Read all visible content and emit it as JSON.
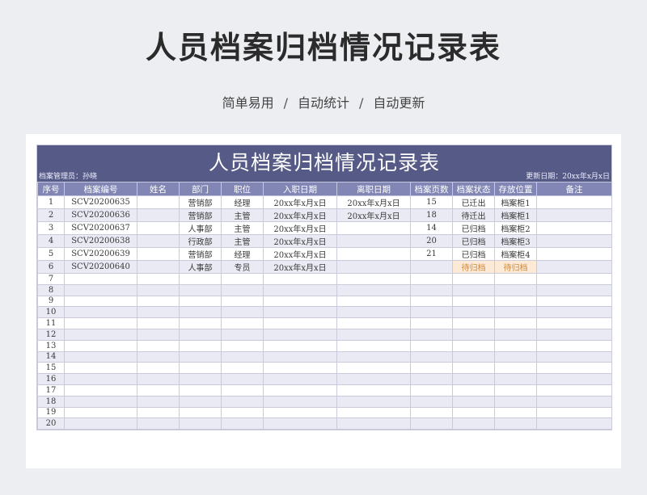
{
  "page": {
    "title": "人员档案归档情况记录表",
    "subtitle": [
      "简单易用",
      "自动统计",
      "自动更新"
    ],
    "subtitle_sep": "/"
  },
  "sheet": {
    "title": "人员档案归档情况记录表",
    "manager_label": "档案管理员：孙晓",
    "update_label": "更新日期：20xx年x月x日",
    "columns": [
      "序号",
      "档案编号",
      "姓名",
      "部门",
      "职位",
      "入职日期",
      "离职日期",
      "档案页数",
      "档案状态",
      "存放位置",
      "备注"
    ],
    "rows": [
      [
        "1",
        "SCV20200635",
        "",
        "营销部",
        "经理",
        "20xx年x月x日",
        "20xx年x月x日",
        "15",
        "已迁出",
        "档案柜1",
        ""
      ],
      [
        "2",
        "SCV20200636",
        "",
        "营销部",
        "主管",
        "20xx年x月x日",
        "20xx年x月x日",
        "18",
        "待迁出",
        "档案柜1",
        ""
      ],
      [
        "3",
        "SCV20200637",
        "",
        "人事部",
        "主管",
        "20xx年x月x日",
        "",
        "14",
        "已归档",
        "档案柜2",
        ""
      ],
      [
        "4",
        "SCV20200638",
        "",
        "行政部",
        "主管",
        "20xx年x月x日",
        "",
        "20",
        "已归档",
        "档案柜3",
        ""
      ],
      [
        "5",
        "SCV20200639",
        "",
        "营销部",
        "经理",
        "20xx年x月x日",
        "",
        "21",
        "已归档",
        "档案柜4",
        ""
      ],
      [
        "6",
        "SCV20200640",
        "",
        "人事部",
        "专员",
        "20xx年x月x日",
        "",
        "",
        "待归档",
        "待归档",
        ""
      ],
      [
        "7",
        "",
        "",
        "",
        "",
        "",
        "",
        "",
        "",
        "",
        ""
      ],
      [
        "8",
        "",
        "",
        "",
        "",
        "",
        "",
        "",
        "",
        "",
        ""
      ],
      [
        "9",
        "",
        "",
        "",
        "",
        "",
        "",
        "",
        "",
        "",
        ""
      ],
      [
        "10",
        "",
        "",
        "",
        "",
        "",
        "",
        "",
        "",
        "",
        ""
      ],
      [
        "11",
        "",
        "",
        "",
        "",
        "",
        "",
        "",
        "",
        "",
        ""
      ],
      [
        "12",
        "",
        "",
        "",
        "",
        "",
        "",
        "",
        "",
        "",
        ""
      ],
      [
        "13",
        "",
        "",
        "",
        "",
        "",
        "",
        "",
        "",
        "",
        ""
      ],
      [
        "14",
        "",
        "",
        "",
        "",
        "",
        "",
        "",
        "",
        "",
        ""
      ],
      [
        "15",
        "",
        "",
        "",
        "",
        "",
        "",
        "",
        "",
        "",
        ""
      ],
      [
        "16",
        "",
        "",
        "",
        "",
        "",
        "",
        "",
        "",
        "",
        ""
      ],
      [
        "17",
        "",
        "",
        "",
        "",
        "",
        "",
        "",
        "",
        "",
        ""
      ],
      [
        "18",
        "",
        "",
        "",
        "",
        "",
        "",
        "",
        "",
        "",
        ""
      ],
      [
        "19",
        "",
        "",
        "",
        "",
        "",
        "",
        "",
        "",
        "",
        ""
      ],
      [
        "20",
        "",
        "",
        "",
        "",
        "",
        "",
        "",
        "",
        "",
        ""
      ]
    ],
    "highlight_color": "#fce9d6",
    "header_color": "#8186b4",
    "banner_color": "#555a86"
  }
}
